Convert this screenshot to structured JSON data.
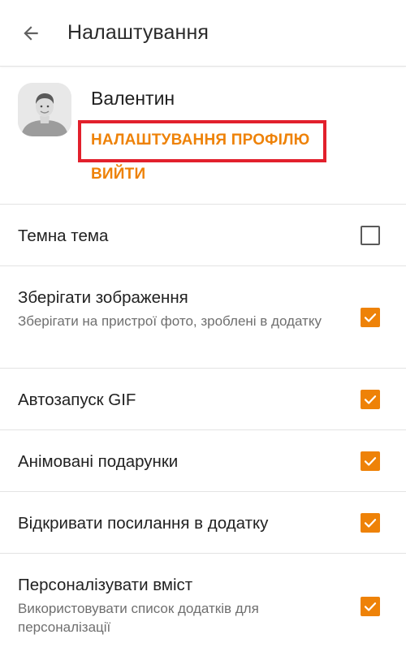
{
  "toolbar": {
    "back_icon": "arrow-left-icon",
    "title": "Налаштування"
  },
  "profile": {
    "avatar_icon": "user-avatar-placeholder",
    "name": "Валентин",
    "settings_link": "НАЛАШТУВАННЯ ПРОФІЛЮ",
    "logout_link": "ВИЙТИ"
  },
  "settings": [
    {
      "title": "Темна тема",
      "description": "",
      "checked": false
    },
    {
      "title": "Зберігати зображення",
      "description": "Зберігати на пристрої фото, зроблені в додатку",
      "checked": true
    },
    {
      "title": "Автозапуск GIF",
      "description": "",
      "checked": true
    },
    {
      "title": "Анімовані подарунки",
      "description": "",
      "checked": true
    },
    {
      "title": "Відкривати посилання в додатку",
      "description": "",
      "checked": true
    },
    {
      "title": "Персоналізувати вміст",
      "description": "Використовувати список додатків для персоналізації",
      "checked": true
    }
  ],
  "colors": {
    "accent": "#ee8208",
    "highlight": "#e2202c",
    "divider": "#e3e3e3"
  }
}
